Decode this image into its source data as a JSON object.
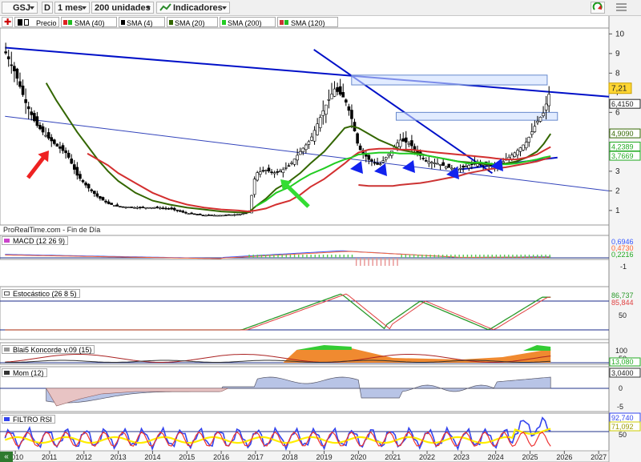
{
  "toolbar": {
    "ticker": "GSJ",
    "period_icon": "D",
    "timeframe": "1 mes",
    "units": "200 unidades",
    "indicators": "Indicadores",
    "refresh_icon": "refresh-icon",
    "menu_icon": "menu-icon"
  },
  "legend": {
    "precio": "Precio",
    "sma40": "SMA (40)",
    "sma4": "SMA (4)",
    "sma20": "SMA (20)",
    "sma200": "SMA (200)",
    "sma120": "SMA (120)"
  },
  "colors": {
    "sma40": "#dd2222",
    "sma4": "#000000",
    "sma20": "#336600",
    "sma200": "#22cc22",
    "sma120": "#cc3333",
    "trendline": "#0010c8",
    "arrow_red": "#ee2222",
    "arrow_green": "#33dd33",
    "arrow_blue": "#1122ee"
  },
  "price_axis": {
    "ticks": [
      "10",
      "9",
      "8",
      "7",
      "6",
      "5",
      "4",
      "3",
      "2",
      "1"
    ],
    "last_price": "7,21",
    "labels": [
      "6,4150",
      "4,9090",
      "4,2389",
      "3,7669"
    ]
  },
  "watermark": "ProRealTime.com - Fin de Día",
  "panels": {
    "macd": {
      "title": "MACD (12 26 9)",
      "values": [
        "0,6946",
        "0,4730",
        "0,2216"
      ]
    },
    "stoch": {
      "title": "Estocástico (26 8 5)",
      "values": [
        "86,737",
        "85,844"
      ],
      "ticks": [
        "50"
      ]
    },
    "konc": {
      "title": "Blai5 Koncorde v.09 (15)",
      "values": [
        "100",
        "13,080"
      ],
      "ticks": [
        "50"
      ]
    },
    "mom": {
      "title": "Mom (12)",
      "values": [
        "3,0400"
      ],
      "ticks": [
        "0",
        "-5"
      ]
    },
    "rsi": {
      "title": "FILTRO RSI",
      "values": [
        "92,740",
        "71,092"
      ],
      "ticks": [
        "50"
      ]
    }
  },
  "xaxis": {
    "years": [
      "2010",
      "2011",
      "2012",
      "2013",
      "2014",
      "2015",
      "2016",
      "2017",
      "2018",
      "2019",
      "2020",
      "2021",
      "2022",
      "2023",
      "2024",
      "2025",
      "2026",
      "2027"
    ]
  },
  "chart_data": {
    "type": "line",
    "title": "GSJ",
    "x": [
      2009.7,
      2010.0,
      2010.3,
      2010.6,
      2010.9,
      2011.2,
      2011.5,
      2011.8,
      2012.1,
      2012.4,
      2012.7,
      2013.0,
      2013.5,
      2014.0,
      2014.5,
      2015.0,
      2015.5,
      2016.0,
      2016.5,
      2016.8,
      2017.0,
      2017.3,
      2017.6,
      2018.0,
      2018.3,
      2018.6,
      2019.0,
      2019.3,
      2019.6,
      2019.8,
      2020.0,
      2020.3,
      2020.6,
      2021.0,
      2021.2,
      2021.5,
      2021.8,
      2022.0,
      2022.3,
      2022.6,
      2022.9,
      2023.2,
      2023.5,
      2023.8,
      2024.0,
      2024.3,
      2024.6,
      2024.9,
      2025.2,
      2025.4,
      2025.6
    ],
    "series": [
      {
        "name": "Precio",
        "values": [
          9.1,
          8.0,
          6.5,
          5.4,
          4.8,
          4.3,
          3.9,
          2.8,
          2.2,
          1.7,
          1.35,
          1.2,
          1.15,
          1.15,
          1.1,
          0.85,
          0.75,
          0.75,
          0.8,
          0.9,
          2.9,
          3.05,
          2.9,
          3.3,
          4.0,
          4.6,
          6.2,
          7.2,
          6.7,
          5.7,
          4.2,
          3.6,
          3.3,
          4.1,
          4.6,
          4.4,
          3.8,
          3.5,
          3.4,
          3.2,
          3.1,
          3.3,
          3.4,
          3.3,
          3.2,
          3.6,
          4.0,
          4.5,
          5.5,
          6.0,
          7.21
        ]
      },
      {
        "name": "SMA (20)",
        "values": [
          null,
          null,
          null,
          null,
          7.5,
          6.6,
          5.8,
          5.0,
          4.3,
          3.6,
          3.0,
          2.5,
          1.9,
          1.5,
          1.3,
          1.15,
          1.05,
          0.95,
          0.9,
          0.9,
          1.2,
          1.6,
          2.1,
          2.5,
          2.9,
          3.4,
          4.0,
          4.6,
          5.2,
          5.3,
          5.2,
          4.9,
          4.6,
          4.3,
          4.1,
          4.0,
          3.9,
          3.8,
          3.7,
          3.6,
          3.5,
          3.45,
          3.4,
          3.35,
          3.35,
          3.4,
          3.5,
          3.7,
          4.0,
          4.4,
          4.909
        ]
      },
      {
        "name": "SMA (40)",
        "values": [
          null,
          null,
          null,
          null,
          null,
          null,
          null,
          null,
          3.9,
          3.6,
          3.3,
          2.9,
          2.4,
          1.9,
          1.55,
          1.3,
          1.15,
          1.05,
          1.0,
          0.95,
          1.0,
          1.1,
          1.3,
          1.5,
          1.8,
          2.2,
          2.6,
          3.0,
          3.4,
          3.7,
          3.95,
          4.1,
          4.15,
          4.15,
          4.1,
          4.1,
          4.05,
          4.0,
          3.95,
          3.9,
          3.85,
          3.8,
          3.75,
          3.7,
          3.65,
          3.6,
          3.6,
          3.7,
          3.85,
          4.05,
          4.2389
        ]
      },
      {
        "name": "SMA (200)",
        "values": [
          null,
          null,
          null,
          null,
          null,
          null,
          null,
          null,
          null,
          null,
          null,
          null,
          null,
          null,
          null,
          null,
          null,
          null,
          null,
          null,
          1.2,
          1.5,
          1.9,
          2.2,
          2.55,
          2.85,
          3.15,
          3.4,
          3.6,
          3.7,
          3.85,
          3.9,
          3.95,
          3.95,
          3.9,
          3.9,
          3.85,
          3.8,
          3.7,
          3.6,
          3.5,
          3.4,
          3.45,
          3.4,
          3.35,
          3.35,
          3.4,
          3.5,
          3.6,
          3.7,
          3.7669
        ]
      },
      {
        "name": "SMA (120)",
        "values": [
          null,
          null,
          null,
          null,
          null,
          null,
          null,
          null,
          null,
          null,
          null,
          null,
          null,
          null,
          null,
          null,
          null,
          null,
          null,
          null,
          null,
          null,
          null,
          null,
          null,
          null,
          null,
          null,
          null,
          null,
          2.3,
          2.25,
          2.25,
          2.25,
          2.3,
          2.35,
          2.4,
          2.45,
          2.55,
          2.65,
          2.75,
          2.9,
          3.0,
          3.1,
          3.15,
          3.2,
          3.3,
          3.4,
          3.5,
          3.6,
          3.7
        ]
      }
    ],
    "xlim": [
      2009.6,
      2027.3
    ],
    "ylim": [
      0.3,
      10.3
    ],
    "grid": false,
    "legend": "top-left"
  }
}
